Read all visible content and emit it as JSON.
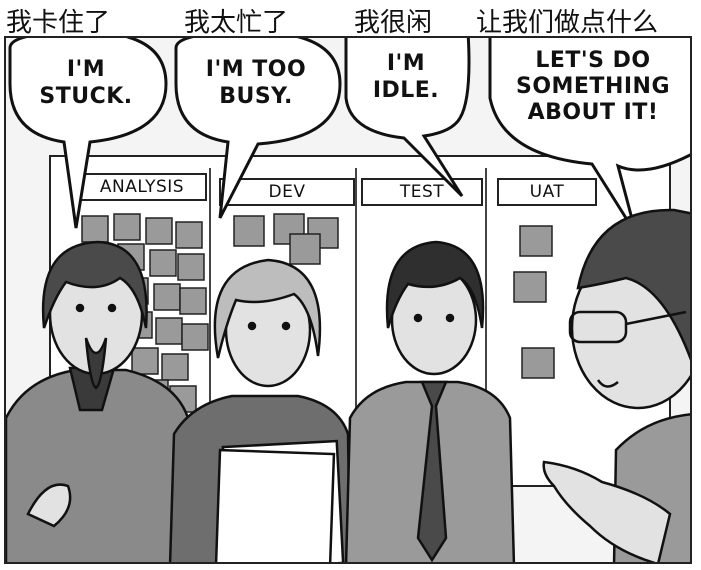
{
  "captions": [
    "我卡住了",
    "我太忙了",
    "我很闲",
    "让我们做点什么"
  ],
  "bubbles": [
    "I'M\nSTUCK.",
    "I'M TOO\nBUSY.",
    "I'M\nIDLE.",
    "LET'S DO\nSOMETHING\nABOUT IT!"
  ],
  "board_columns": [
    "ANALYSIS",
    "DEV",
    "TEST",
    "UAT"
  ],
  "colors": {
    "ink": "#111111",
    "sticky": "#9a9a9a",
    "skin": "#e2e2e2",
    "hair": "#4a4a4a"
  }
}
